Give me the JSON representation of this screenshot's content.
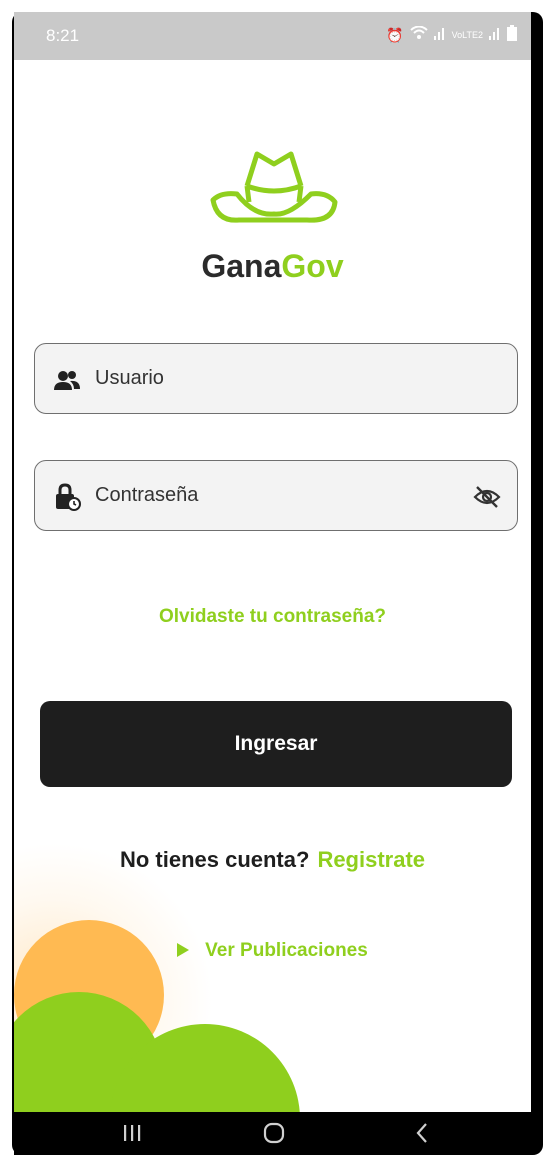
{
  "status_bar": {
    "time": "8:21",
    "icons": [
      "alarm-icon",
      "wifi-icon",
      "signal-icon",
      "volte-icon",
      "signal-icon",
      "battery-icon"
    ],
    "volte_label": "VoLTE2"
  },
  "brand": {
    "name_part1": "Gana",
    "name_part2": "Gov",
    "logo_icon": "cowboy-hat-icon",
    "colors": {
      "dark": "#2b2b2b",
      "green": "#8fcf1e"
    }
  },
  "form": {
    "username": {
      "placeholder": "Usuario",
      "icon": "users-icon"
    },
    "password": {
      "placeholder": "Contraseña",
      "icon": "lock-clock-icon",
      "toggle_icon": "eye-off-icon"
    }
  },
  "links": {
    "forgot": "Olvidaste tu contraseña?",
    "signup_prompt": "No tienes cuenta?",
    "signup_link": "Registrate",
    "publications": "Ver Publicaciones"
  },
  "buttons": {
    "login": "Ingresar"
  },
  "colors": {
    "accent": "#8fcf1e",
    "button_bg": "#1e1e1e",
    "sun": "#ffba52"
  },
  "nav_bar": {
    "items": [
      "recents-icon",
      "home-icon",
      "back-icon"
    ]
  }
}
